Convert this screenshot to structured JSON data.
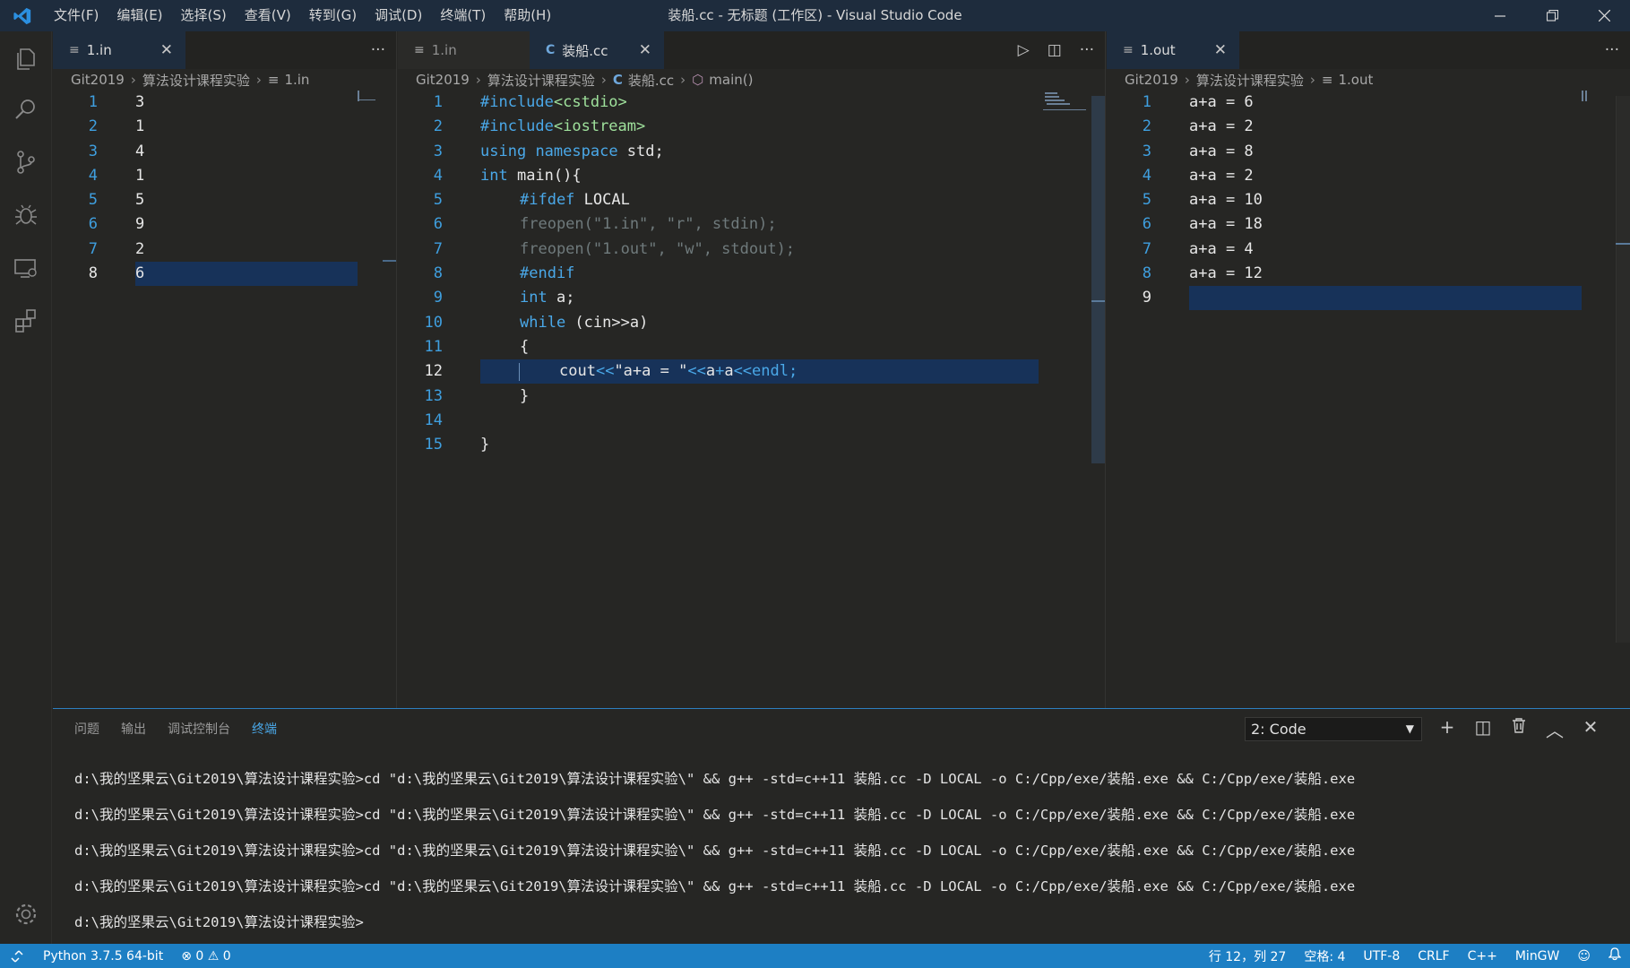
{
  "titlebar": {
    "menu": [
      "文件(F)",
      "编辑(E)",
      "选择(S)",
      "查看(V)",
      "转到(G)",
      "调试(D)",
      "终端(T)",
      "帮助(H)"
    ],
    "title": "装船.cc - 无标题 (工作区) - Visual Studio Code"
  },
  "group1": {
    "tab": {
      "icon": "≡",
      "label": "1.in",
      "close": "✕"
    },
    "more": "···",
    "breadcrumb": [
      "Git2019",
      "算法设计课程实验",
      "1.in"
    ],
    "lines": [
      {
        "n": "1",
        "text": "3"
      },
      {
        "n": "2",
        "text": "1"
      },
      {
        "n": "3",
        "text": "4"
      },
      {
        "n": "4",
        "text": "1"
      },
      {
        "n": "5",
        "text": "5"
      },
      {
        "n": "6",
        "text": "9"
      },
      {
        "n": "7",
        "text": "2"
      },
      {
        "n": "8",
        "text": "6"
      }
    ]
  },
  "group2": {
    "tabs": [
      {
        "icon": "≡",
        "label": "1.in"
      },
      {
        "icon": "C",
        "label": "装船.cc",
        "close": "✕"
      }
    ],
    "actions": [
      "▷",
      "◫",
      "···"
    ],
    "breadcrumb": [
      "Git2019",
      "算法设计课程实验",
      "装船.cc",
      "main()"
    ],
    "line_numbers": [
      "1",
      "2",
      "3",
      "4",
      "5",
      "6",
      "7",
      "8",
      "9",
      "10",
      "11",
      "12",
      "13",
      "14",
      "15"
    ],
    "code": {
      "l1a": "#include",
      "l1b": "<cstdio>",
      "l2a": "#include",
      "l2b": "<iostream>",
      "l3a": "using",
      "l3b": "namespace",
      "l3c": " std;",
      "l4a": "int",
      "l4b": " main(){",
      "l5a": "#ifdef",
      "l5b": " LOCAL",
      "l6": "freopen(\"1.in\", \"r\", stdin);",
      "l7": "freopen(\"1.out\", \"w\", stdout);",
      "l8": "#endif",
      "l9a": "int",
      "l9b": " a;",
      "l10a": "while",
      "l10b": " (cin>>a)",
      "l11": "{",
      "l12a": "cout",
      "l12b": "<<",
      "l12c": "\"a+a = \"",
      "l12d": "<<",
      "l12e": "a",
      "l12f": "+",
      "l12g": "a",
      "l12h": "<<",
      "l12i": "endl;",
      "l13": "}",
      "l15": "}"
    }
  },
  "group3": {
    "tab": {
      "icon": "≡",
      "label": "1.out",
      "close": "✕"
    },
    "more": "···",
    "breadcrumb": [
      "Git2019",
      "算法设计课程实验",
      "1.out"
    ],
    "lines": [
      {
        "n": "1",
        "text": "a+a = 6"
      },
      {
        "n": "2",
        "text": "a+a = 2"
      },
      {
        "n": "3",
        "text": "a+a = 8"
      },
      {
        "n": "4",
        "text": "a+a = 2"
      },
      {
        "n": "5",
        "text": "a+a = 10"
      },
      {
        "n": "6",
        "text": "a+a = 18"
      },
      {
        "n": "7",
        "text": "a+a = 4"
      },
      {
        "n": "8",
        "text": "a+a = 12"
      },
      {
        "n": "9",
        "text": ""
      }
    ]
  },
  "panel": {
    "tabs": [
      "问题",
      "输出",
      "调试控制台",
      "终端"
    ],
    "terminal_select": "2: Code",
    "actions": [
      "+",
      "◫",
      "🗑",
      "︿",
      "✕"
    ],
    "terminal_lines": [
      "d:\\我的坚果云\\Git2019\\算法设计课程实验>cd \"d:\\我的坚果云\\Git2019\\算法设计课程实验\\\" && g++ -std=c++11 装船.cc -D LOCAL -o C:/Cpp/exe/装船.exe && C:/Cpp/exe/装船.exe",
      "d:\\我的坚果云\\Git2019\\算法设计课程实验>cd \"d:\\我的坚果云\\Git2019\\算法设计课程实验\\\" && g++ -std=c++11 装船.cc -D LOCAL -o C:/Cpp/exe/装船.exe && C:/Cpp/exe/装船.exe",
      "d:\\我的坚果云\\Git2019\\算法设计课程实验>cd \"d:\\我的坚果云\\Git2019\\算法设计课程实验\\\" && g++ -std=c++11 装船.cc -D LOCAL -o C:/Cpp/exe/装船.exe && C:/Cpp/exe/装船.exe",
      "d:\\我的坚果云\\Git2019\\算法设计课程实验>cd \"d:\\我的坚果云\\Git2019\\算法设计课程实验\\\" && g++ -std=c++11 装船.cc -D LOCAL -o C:/Cpp/exe/装船.exe && C:/Cpp/exe/装船.exe",
      "d:\\我的坚果云\\Git2019\\算法设计课程实验>"
    ]
  },
  "statusbar": {
    "python": "Python 3.7.5 64-bit",
    "errors": "0",
    "warnings": "0",
    "position": "行 12，列 27",
    "spaces": "空格: 4",
    "encoding": "UTF-8",
    "eol": "CRLF",
    "language": "C++",
    "compiler": "MinGW"
  },
  "colors": {
    "titlebar": "#1e2c3d",
    "editor_bg": "#262624",
    "line_highlight": "#173259",
    "accent": "#1d7fc4",
    "keyword": "#4aa8e8",
    "include_path": "#9fe19c"
  },
  "icons": [
    "vscode-logo-icon",
    "explorer-icon",
    "search-icon",
    "source-control-icon",
    "debug-icon",
    "remote-explorer-icon",
    "extensions-icon",
    "settings-gear-icon"
  ]
}
